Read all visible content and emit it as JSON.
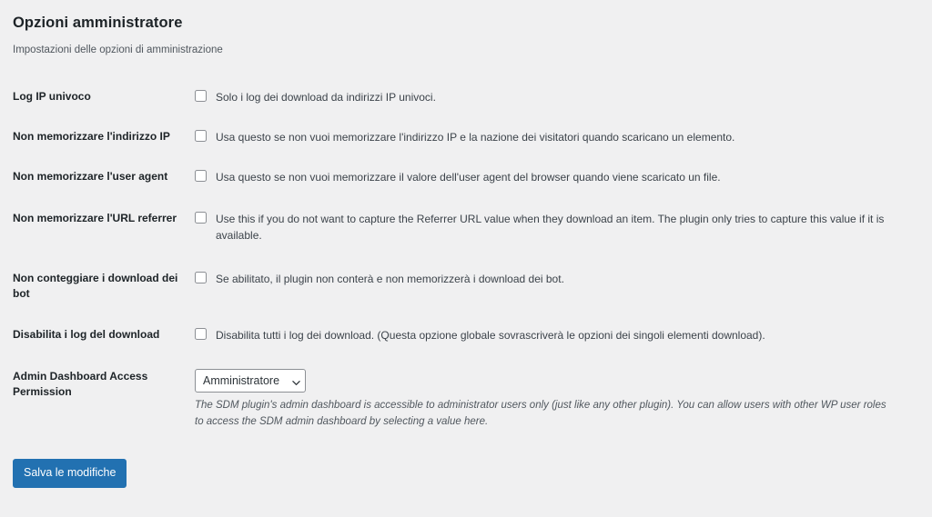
{
  "header": {
    "title": "Opzioni amministratore",
    "subtitle": "Impostazioni delle opzioni di amministrazione"
  },
  "colors": {
    "background": "#f0f0f1",
    "heading_text": "#1d2327",
    "body_text": "#3c434a",
    "muted_text": "#50575e",
    "primary_button": "#2271b1",
    "control_border": "#8c8f94"
  },
  "rows": [
    {
      "label": "Log IP univoco",
      "description": "Solo i log dei download da indirizzi IP univoci.",
      "checked": false
    },
    {
      "label": "Non memorizzare l'indirizzo IP",
      "description": "Usa questo se non vuoi memorizzare l'indirizzo IP e la nazione dei visitatori quando scaricano un elemento.",
      "checked": false
    },
    {
      "label": "Non memorizzare l'user agent",
      "description": "Usa questo se non vuoi memorizzare il valore dell'user agent del browser quando viene scaricato un file.",
      "checked": false
    },
    {
      "label": "Non memorizzare l'URL referrer",
      "description": "Use this if you do not want to capture the Referrer URL value when they download an item. The plugin only tries to capture this value if it is available.",
      "checked": false
    },
    {
      "label": "Non conteggiare i download dei bot",
      "description": "Se abilitato, il plugin non conterà e non memorizzerà i download dei bot.",
      "checked": false
    },
    {
      "label": "Disabilita i log del download",
      "description": "Disabilita tutti i log dei download. (Questa opzione globale sovrascriverà le opzioni dei singoli elementi download).",
      "checked": false
    }
  ],
  "permission_row": {
    "label": "Admin Dashboard Access Permission",
    "selected_option": "Amministratore",
    "options": [
      "Amministratore"
    ],
    "help_text": "The SDM plugin's admin dashboard is accessible to administrator users only (just like any other plugin). You can allow users with other WP user roles to access the SDM admin dashboard by selecting a value here.",
    "chevron_icon": "chevron-down-icon"
  },
  "submit": {
    "label": "Salva le modifiche"
  }
}
